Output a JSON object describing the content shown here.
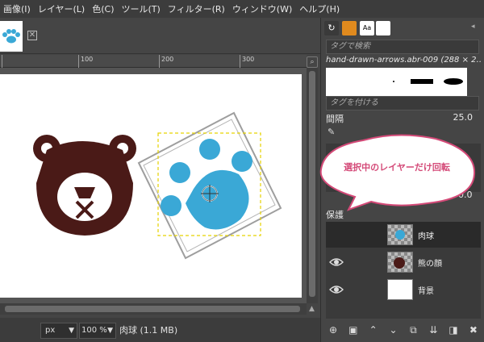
{
  "menubar": {
    "items": [
      "画像(I)",
      "レイヤー(L)",
      "色(C)",
      "ツール(T)",
      "フィルター(R)",
      "ウィンドウ(W)",
      "ヘルプ(H)"
    ]
  },
  "ruler": {
    "labels": [
      "100",
      "200",
      "300"
    ]
  },
  "statusbar": {
    "unit": "px",
    "zoom": "100 %",
    "layer_info": "肉球 (1.1 MB)"
  },
  "dock": {
    "brush_search_placeholder": "タグで検索",
    "brush_name": "hand-drawn-arrows.abr-009 (288 × 2…",
    "tag_placeholder": "タグを付ける",
    "spacing_label": "間隔",
    "spacing_value": "25.0",
    "opacity_value": "0.0",
    "lock_label": "保護",
    "layers": [
      {
        "name": "肉球",
        "visible": false,
        "selected": true
      },
      {
        "name": "熊の顔",
        "visible": true,
        "selected": false
      },
      {
        "name": "背景",
        "visible": true,
        "selected": false
      }
    ]
  },
  "callout": {
    "text": "選択中のレイヤーだけ回転"
  },
  "colors": {
    "bear": "#4a1a17",
    "paw": "#3aa8d6",
    "callout_border": "#d44a78"
  }
}
